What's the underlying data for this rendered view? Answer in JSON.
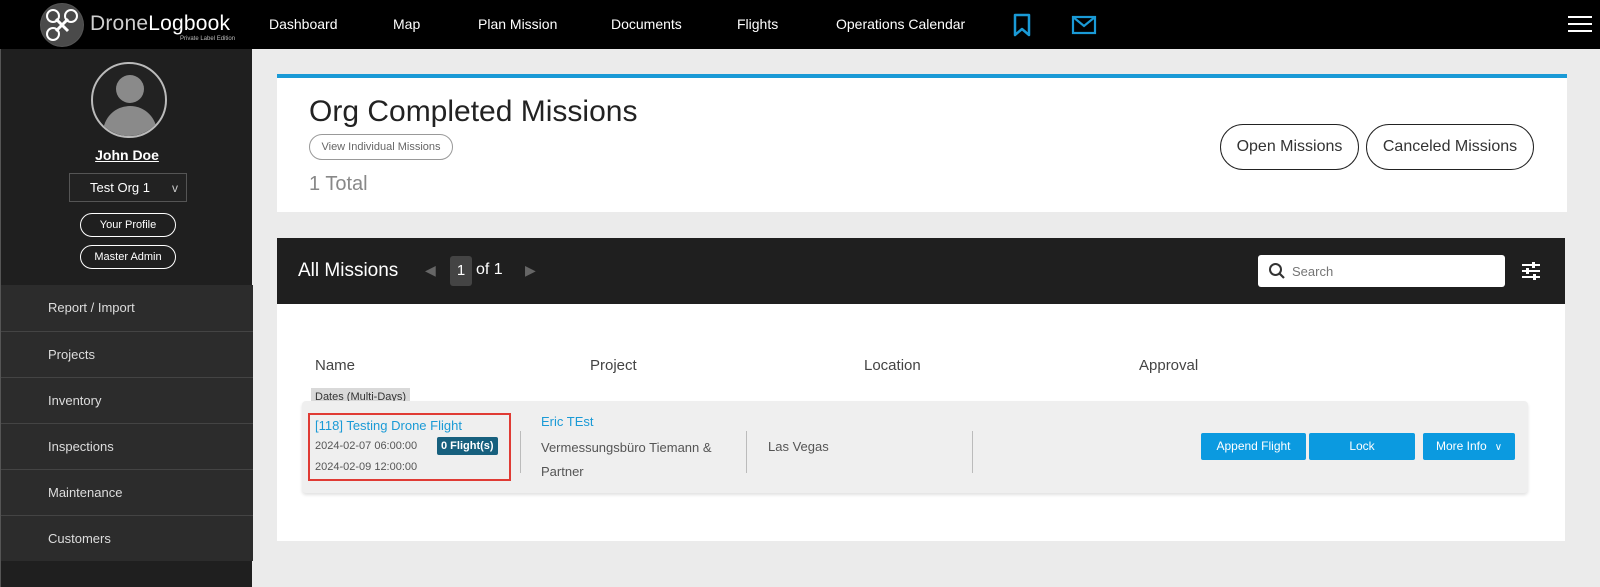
{
  "topnav": {
    "logo_text_a": "Drone",
    "logo_text_b": "Logbook",
    "logo_sub": "Private Label Edition",
    "items": [
      "Dashboard",
      "Map",
      "Plan Mission",
      "Documents",
      "Flights",
      "Operations Calendar"
    ],
    "accent": "#1a9ad6"
  },
  "sidebar": {
    "user_name": "John Doe",
    "org": "Test Org 1",
    "org_caret": "v",
    "profile_btn": "Your Profile",
    "admin_btn": "Master Admin",
    "menu": [
      "Report / Import",
      "Projects",
      "Inventory",
      "Inspections",
      "Maintenance",
      "Customers"
    ]
  },
  "header": {
    "title": "Org Completed Missions",
    "view_individual": "View Individual Missions",
    "total": "1 Total",
    "open_missions": "Open Missions",
    "canceled_missions": "Canceled Missions"
  },
  "list": {
    "title": "All Missions",
    "page": "1",
    "of": "of 1",
    "search_placeholder": "Search"
  },
  "table": {
    "columns": [
      "Name",
      "Project",
      "Location",
      "Approval"
    ],
    "dates_tag": "Dates (Multi-Days)",
    "rows": [
      {
        "mission": "[118] Testing Drone Flight",
        "start": "2024-02-07 06:00:00",
        "end": "2024-02-09 12:00:00",
        "flights": "0 Flight(s)",
        "project_link": "Eric TEst",
        "project_name": "Vermessungsbüro Tiemann & Partner",
        "location": "Las Vegas",
        "actions": {
          "append": "Append Flight",
          "lock": "Lock",
          "more": "More Info"
        }
      }
    ]
  }
}
